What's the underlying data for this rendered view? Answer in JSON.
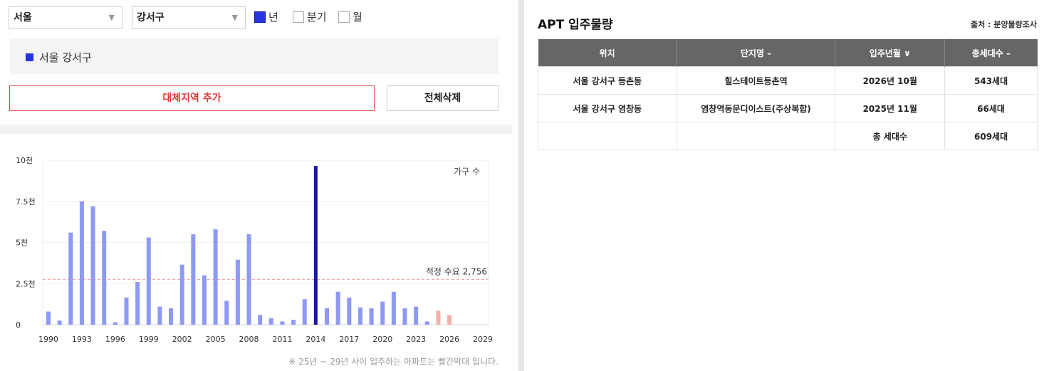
{
  "controls": {
    "city": "서울",
    "district": "강서구",
    "period_options": [
      {
        "label": "년",
        "checked": true
      },
      {
        "label": "분기",
        "checked": false
      },
      {
        "label": "월",
        "checked": false
      }
    ]
  },
  "region_tag": "서울 강서구",
  "buttons": {
    "add_region": "대체지역 추가",
    "clear_all": "전체삭제"
  },
  "chart_data": {
    "type": "bar",
    "legend": "가구 수",
    "x": [
      1990,
      1991,
      1992,
      1993,
      1994,
      1995,
      1996,
      1997,
      1998,
      1999,
      2000,
      2001,
      2002,
      2003,
      2004,
      2005,
      2006,
      2007,
      2008,
      2009,
      2010,
      2011,
      2012,
      2013,
      2014,
      2015,
      2016,
      2017,
      2018,
      2019,
      2020,
      2021,
      2022,
      2023,
      2024,
      2025,
      2026,
      2027,
      2028,
      2029
    ],
    "values": [
      800,
      250,
      5600,
      7500,
      7200,
      5700,
      150,
      1650,
      2600,
      5300,
      1100,
      1000,
      3650,
      5500,
      3000,
      5800,
      1450,
      3950,
      5500,
      600,
      400,
      200,
      300,
      1550,
      9650,
      1000,
      2000,
      1650,
      1050,
      1000,
      1400,
      2000,
      1000,
      1100,
      200,
      850,
      600,
      0,
      0,
      0
    ],
    "highlight_year": 2014,
    "forecast_years": [
      2025,
      2026,
      2027,
      2028,
      2029
    ],
    "yticks": [
      {
        "value": 0,
        "label": "0"
      },
      {
        "value": 2500,
        "label": "2.5천"
      },
      {
        "value": 5000,
        "label": "5천"
      },
      {
        "value": 7500,
        "label": "7.5천"
      },
      {
        "value": 10000,
        "label": "10천"
      }
    ],
    "xtick_labels": [
      "1990",
      "1993",
      "1996",
      "1999",
      "2002",
      "2005",
      "2008",
      "2011",
      "2014",
      "2017",
      "2020",
      "2023",
      "2026",
      "2029"
    ],
    "ylim": [
      0,
      10000
    ],
    "reference_line": {
      "value": 2756,
      "label": "적정 수요 2,756"
    },
    "colors": {
      "bar": "#8d99f3",
      "highlight": "#1a16a8",
      "forecast": "#f5b1a8",
      "reference": "#f29a9a"
    }
  },
  "note": "※ 25년 ~ 29년 사이 입주하는 아파트는 빨간막대 입니다.",
  "panel": {
    "title": "APT 입주물량",
    "source": "출처 : 분양물량조사",
    "columns": [
      "위치",
      "단지명 –",
      "입주년월 ∨",
      "총세대수 –"
    ],
    "rows": [
      [
        "서울 강서구 등촌동",
        "힐스테이트등촌역",
        "2026년 10월",
        "543세대"
      ],
      [
        "서울 강서구 염창동",
        "염창역동문디이스트(주상복합)",
        "2025년 11월",
        "66세대"
      ],
      [
        "",
        "",
        "총 세대수",
        "609세대"
      ]
    ]
  }
}
